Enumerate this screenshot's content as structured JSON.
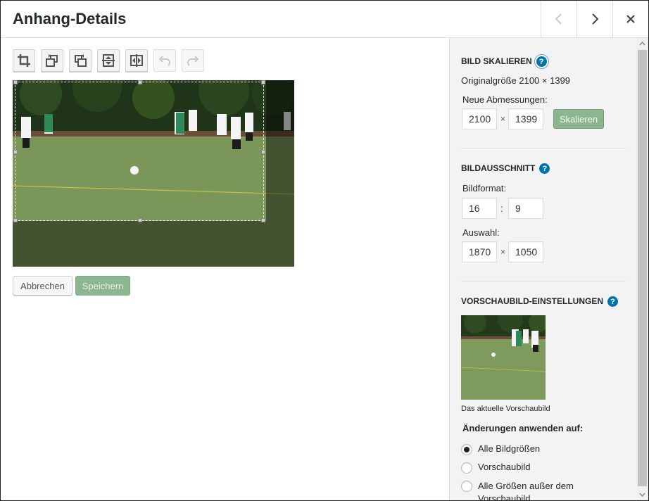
{
  "header": {
    "title": "Anhang-Details",
    "prev_icon": "chevron-left-icon",
    "next_icon": "chevron-right-icon",
    "close_icon": "close-icon"
  },
  "toolbar": {
    "tools": [
      "crop-icon",
      "rotate-left-icon",
      "rotate-right-icon",
      "flip-vertical-icon",
      "flip-horizontal-icon",
      "undo-icon",
      "redo-icon"
    ]
  },
  "actions": {
    "cancel_label": "Abbrechen",
    "save_label": "Speichern"
  },
  "scale": {
    "title": "Bild skalieren",
    "original_size": "Originalgröße 2100 × 1399",
    "new_dimensions_label": "Neue Abmessungen:",
    "width": "2100",
    "height": "1399",
    "times": "×",
    "button_label": "Skalieren"
  },
  "crop": {
    "title": "Bildausschnitt",
    "aspect_label": "Bildformat:",
    "aspect_w": "16",
    "aspect_h": "9",
    "colon": ":",
    "selection_label": "Auswahl:",
    "sel_w": "1870",
    "sel_h": "1050",
    "times": "×"
  },
  "thumbnail": {
    "title": "Vorschaubild-Einstellungen",
    "caption": "Das aktuelle Vorschaubild",
    "apply_label": "Änderungen anwenden auf:",
    "options": [
      "Alle Bildgrößen",
      "Vorschaubild",
      "Alle Größen außer dem Vorschaubild"
    ],
    "selected_index": 0
  },
  "help_symbol": "?",
  "colors": {
    "accent": "#0073aa",
    "primary_disabled": "#8bb690"
  }
}
